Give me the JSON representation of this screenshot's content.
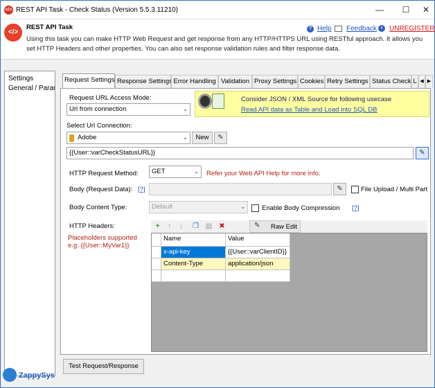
{
  "window": {
    "title": "REST API Task - Check Status (Version 5.5.3.11210)",
    "controls": {
      "minimize": "—",
      "maximize": "☐",
      "close": "✕"
    }
  },
  "header": {
    "title": "REST API Task",
    "description": "Using this task you can make HTTP Web Request and get response from any HTTP/HTTPS URL using RESTful approach. It allows you set HTTP Headers and other properties. You can also set response validation rules and filter response data.",
    "help_link": "Help",
    "feedback_link": "Feedback",
    "unregistered_link": "UNREGISTERED"
  },
  "leftnav": {
    "items": [
      "Settings",
      "General / Parar"
    ]
  },
  "tabs": [
    "Request Settings",
    "Response Settings",
    "Error Handling",
    "Validation",
    "Proxy Settings",
    "Cookies",
    "Retry Settings",
    "Status Check",
    "L"
  ],
  "tab_scroll": {
    "left": "◀",
    "right": "▶"
  },
  "request": {
    "url_access_mode_label": "Request URL Access Mode:",
    "url_access_mode_value": "Url from connection",
    "usecase_text": "Consider JSON / XML Source for following usecase",
    "usecase_link": "Read API data as Table and Load into SQL DB",
    "url_connection_label": "Select Url Connection:",
    "url_connection_value": "Adobe",
    "new_button": "New",
    "url_value": "{{User::varCheckStatusURL}}",
    "method_label": "HTTP Request Method:",
    "method_value": "GET",
    "method_hint": "Refer your Web API Help for more info.",
    "body_label": "Body (Request Data):",
    "body_help": "[?]",
    "file_upload_label": "File Upload / Multi Part",
    "content_type_label": "Body Content Type:",
    "content_type_value": "Default",
    "compression_label": "Enable Body Compression",
    "compression_help": "[?]",
    "headers_label": "HTTP Headers:",
    "placeholder_note_1": "Placeholders supported",
    "placeholder_note_2": "e.g. {{User::MyVar1}}",
    "raw_edit_button": "Raw Edit"
  },
  "headers_grid": {
    "columns": [
      "Name",
      "Value"
    ],
    "rows": [
      {
        "name": "x-api-key",
        "value": "{{User::varClientID}}"
      },
      {
        "name": "Content-Type",
        "value": "application/json"
      },
      {
        "name": "",
        "value": ""
      }
    ]
  },
  "footer": {
    "test_button": "Test Request/Response",
    "brand": "ZappySys"
  },
  "colors": {
    "accent": "#1f53c4",
    "brand": "#e8402a",
    "selection": "#0078d7",
    "warning_text": "#b02015",
    "usecase_bg": "#ffffa0"
  }
}
